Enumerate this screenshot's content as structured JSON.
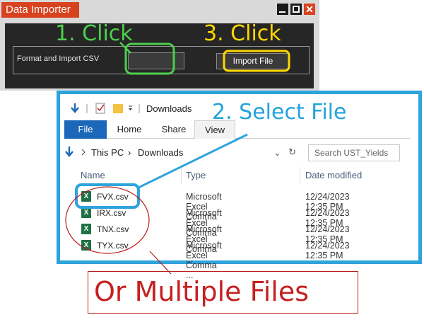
{
  "window": {
    "title": "Data Importer",
    "close_glyph": "✕",
    "format_label": "Format and Import CSV",
    "import_button": "Import File"
  },
  "explorer": {
    "quick_access_title": "Downloads",
    "tabs": [
      "File",
      "Home",
      "Share",
      "View"
    ],
    "breadcrumb": [
      "This PC",
      "Downloads"
    ],
    "search_placeholder": "Search UST_Yields",
    "columns": {
      "name": "Name",
      "type": "Type",
      "date": "Date modified"
    },
    "files": [
      {
        "name": "FVX.csv",
        "type": "Microsoft Excel Comma ...",
        "date": "12/24/2023 12:35 PM"
      },
      {
        "name": "IRX.csv",
        "type": "Microsoft Excel Comma ...",
        "date": "12/24/2023 12:35 PM"
      },
      {
        "name": "TNX.csv",
        "type": "Microsoft Excel Comma ...",
        "date": "12/24/2023 12:35 PM"
      },
      {
        "name": "TYX.csv",
        "type": "Microsoft Excel Comma ...",
        "date": "12/24/2023 12:35 PM"
      }
    ]
  },
  "annotations": {
    "step1": "1. Click",
    "step2": "2. Select File",
    "step3": "3. Click",
    "multiple": "Or Multiple Files"
  },
  "colors": {
    "step1": "#4cd04c",
    "step2": "#24a3db",
    "step3": "#ffd700",
    "multiple": "#c62020",
    "title_bar": "#d9421f"
  }
}
